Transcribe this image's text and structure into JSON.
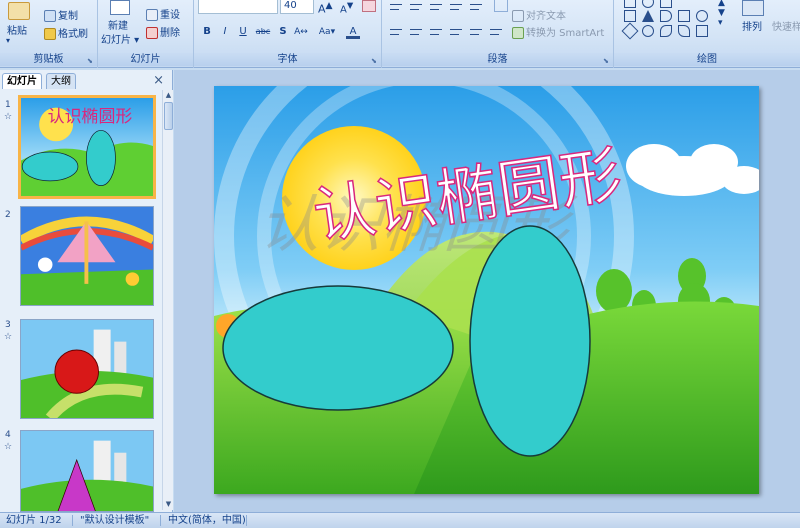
{
  "ribbon": {
    "clipboard": {
      "label": "剪贴板",
      "paste": "粘贴",
      "copy": "复制",
      "format_painter": "格式刷"
    },
    "slides": {
      "label": "幻灯片",
      "new_slide": "新建",
      "new_slide_2": "幻灯片",
      "reset": "重设",
      "delete": "删除"
    },
    "font": {
      "label": "字体",
      "size": "40"
    },
    "paragraph": {
      "label": "段落",
      "align_text": "对齐文本",
      "convert_smartart": "转换为 SmartArt"
    },
    "drawing": {
      "label": "绘图",
      "arrange": "排列",
      "quick_styles": "快速样"
    }
  },
  "pane": {
    "tab_slides": "幻灯片",
    "tab_outline": "大纲",
    "close": "×",
    "thumbnails": [
      {
        "num": "1",
        "star": "☆"
      },
      {
        "num": "2",
        "star": ""
      },
      {
        "num": "3",
        "star": "☆"
      },
      {
        "num": "4",
        "star": "☆"
      }
    ]
  },
  "slide": {
    "title": "认识椭圆形",
    "colors": {
      "ellipse": "#33cccc",
      "title": "#d9277e",
      "sun": "#ffe14d",
      "grass": "#4fbf2a",
      "sky": "#3aa8ef"
    }
  },
  "status": {
    "slide_counter": "幻灯片 1/32",
    "theme": "\"默认设计模板\"",
    "language": "中文(简体，中国)"
  },
  "thumbs": {
    "t1_title": "认识椭圆形"
  }
}
